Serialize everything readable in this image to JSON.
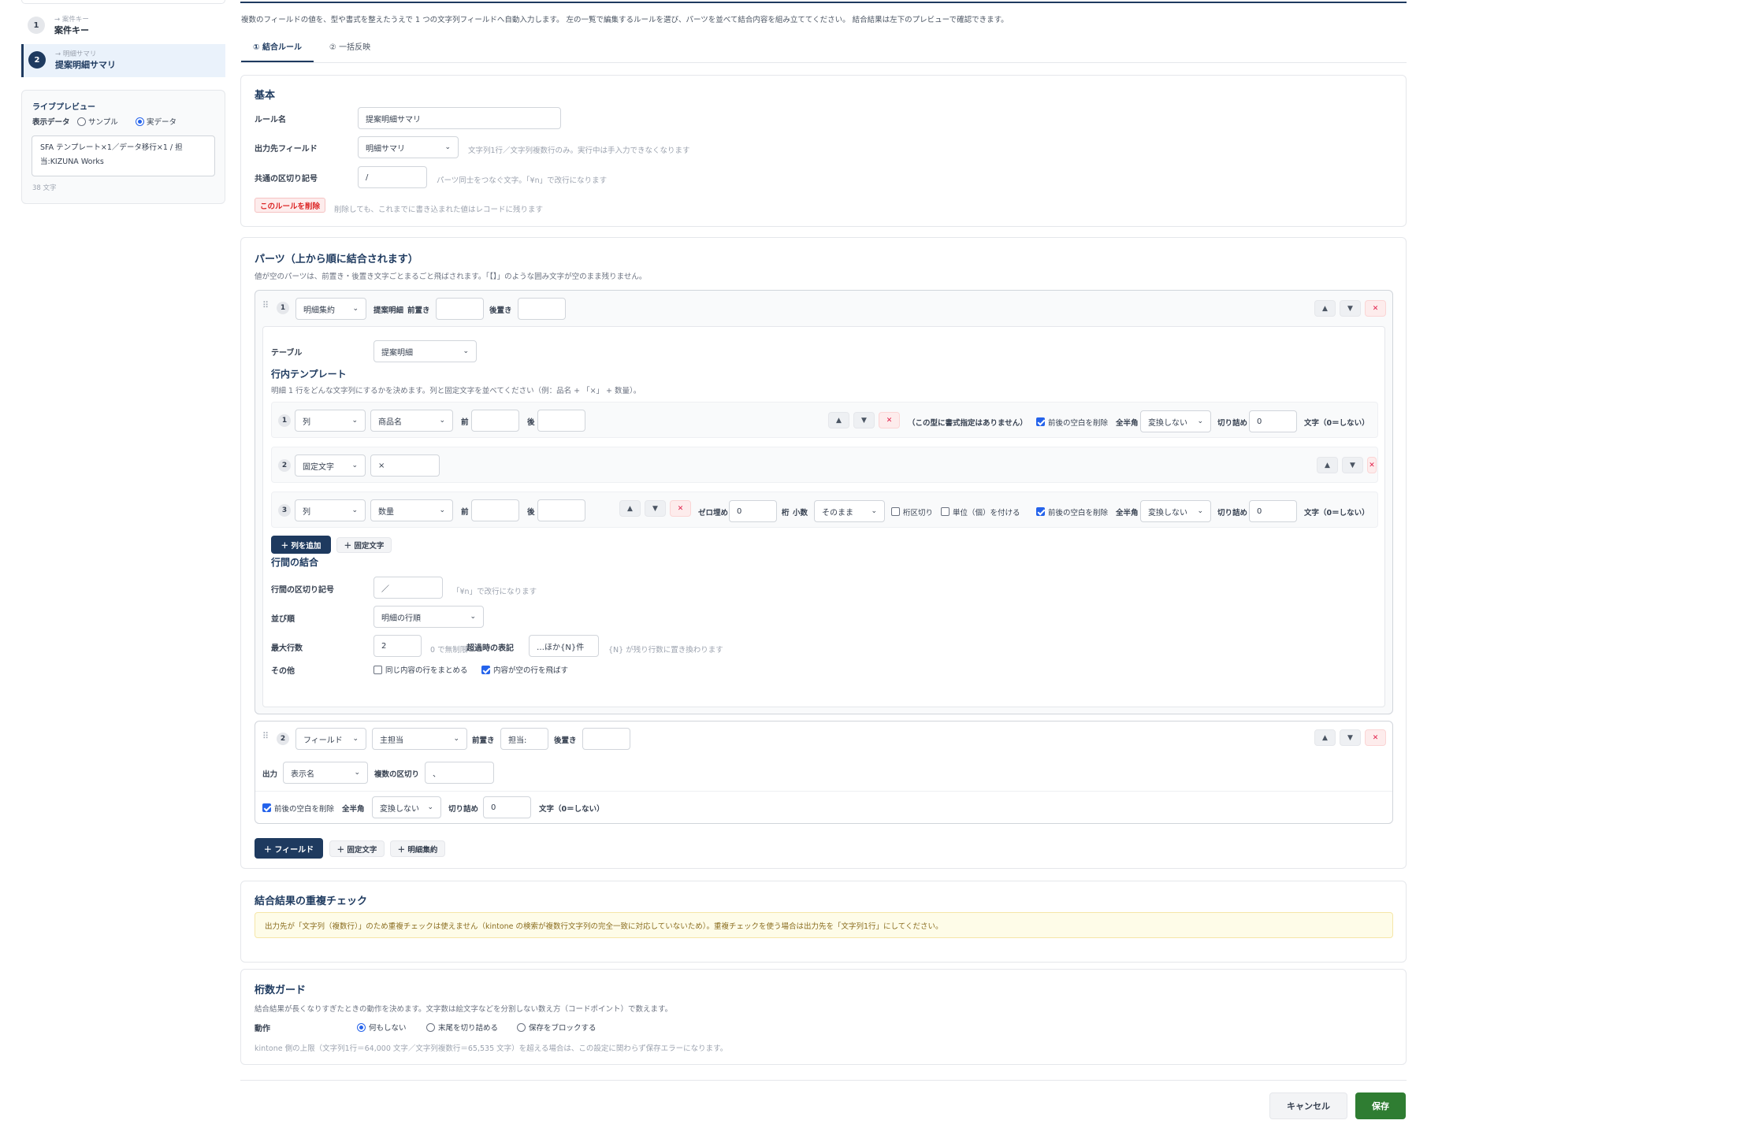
{
  "sidebar": {
    "steps": [
      {
        "num": "1",
        "small": "→ 案件キー",
        "name": "案件キー"
      },
      {
        "num": "2",
        "small": "→ 明細サマリ",
        "name": "提案明細サマリ"
      }
    ],
    "preview": {
      "title": "ライブプレビュー",
      "data_label": "表示データ",
      "option_sample": "サンプル",
      "option_real": "実データ",
      "text": "SFA テンプレート×1／データ移行×1 / 担当:KIZUNA Works",
      "count": "38 文字"
    }
  },
  "header": {
    "intro": "複数のフィールドの値を、型や書式を整えたうえで 1 つの文字列フィールドへ自動入力します。 左の一覧で編集するルールを選び、パーツを並べて結合内容を組み立ててください。 結合結果は左下のプレビューで確認できます。",
    "tabs": [
      "① 結合ルール",
      "② 一括反映"
    ]
  },
  "basic": {
    "title": "基本",
    "rule_name_label": "ルール名",
    "rule_name_value": "提案明細サマリ",
    "output_label": "出力先フィールド",
    "output_value": "明細サマリ",
    "output_note": "文字列1行／文字列複数行のみ。実行中は手入力できなくなります",
    "sep_label": "共通の区切り記号",
    "sep_value": "/",
    "sep_note": "パーツ同士をつなぐ文字。「¥n」で改行になります",
    "delete_button": "このルールを削除",
    "delete_note": "削除しても、これまでに書き込まれた値はレコードに残ります"
  },
  "parts": {
    "title": "パーツ（上から順に結合されます）",
    "desc": "値が空のパーツは、前置き・後置き文字ごとまるごと飛ばされます。「【】」のような囲み文字が空のまま残りません。",
    "part1": {
      "num": "1",
      "type": "明細集約",
      "tag": "提案明細",
      "pre_label": "前置き",
      "post_label": "後置き",
      "table_label": "テーブル",
      "table_value": "提案明細",
      "template_title": "行内テンプレート",
      "template_desc": "明細 1 行をどんな文字列にするかを決めます。列と固定文字を並べてください（例：品名 + 「×」 + 数量）。",
      "rows": [
        {
          "num": "1",
          "type": "列",
          "field": "商品名",
          "pre": "前",
          "post": "後",
          "fmt_note": "（この型に書式指定はありません）",
          "trim_label": "前後の空白を削除",
          "width_label": "全半角",
          "width_value": "変換しない",
          "cut_label": "切り詰め",
          "cut_value": "0",
          "cut_unit": "文字（0＝しない）"
        },
        {
          "num": "2",
          "type": "固定文字",
          "value": "×"
        },
        {
          "num": "3",
          "type": "列",
          "field": "数量",
          "pre": "前",
          "post": "後",
          "zero_label": "ゼロ埋め",
          "zero_value": "0",
          "digit_label": "桁",
          "dec_label": "小数",
          "dec_value": "そのまま",
          "comma_label": "桁区切り",
          "unit_label": "単位（個）を付ける",
          "trim_label": "前後の空白を削除",
          "width_label": "全半角",
          "width_value": "変換しない",
          "cut_label": "切り詰め",
          "cut_value": "0",
          "cut_unit": "文字（0＝しない）"
        }
      ],
      "add_col_button": "＋ 列を追加",
      "add_fixed_button": "＋ 固定文字",
      "join_title": "行間の結合",
      "row_sep_label": "行間の区切り記号",
      "row_sep_value": "／",
      "row_sep_note": "「¥n」で改行になります",
      "order_label": "並び順",
      "order_value": "明細の行順",
      "max_label": "最大行数",
      "max_value": "2",
      "max_note": "0 で無制限",
      "over_label": "超過時の表記",
      "over_value": "…ほか{N}件",
      "over_note": "{N} が残り行数に置き換わります",
      "other_label": "その他",
      "merge_label": "同じ内容の行をまとめる",
      "skip_label": "内容が空の行を飛ばす"
    },
    "part2": {
      "num": "2",
      "type": "フィールド",
      "field": "主担当",
      "pre_label": "前置き",
      "pre_value": "担当:",
      "post_label": "後置き",
      "out_label": "出力",
      "out_value": "表示名",
      "multi_label": "複数の区切り",
      "multi_value": "、",
      "trim_label": "前後の空白を削除",
      "width_label": "全半角",
      "width_value": "変換しない",
      "cut_label": "切り詰め",
      "cut_value": "0",
      "cut_unit": "文字（0＝しない）"
    },
    "add_field_button": "＋ フィールド",
    "add_fixed_button": "＋ 固定文字",
    "add_agg_button": "＋ 明細集約"
  },
  "dup": {
    "title": "結合結果の重複チェック",
    "warning": "出力先が「文字列（複数行）」のため重複チェックは使えません（kintone の検索が複数行文字列の完全一致に対応していないため）。重複チェックを使う場合は出力先を「文字列1行」にしてください。"
  },
  "guard": {
    "title": "桁数ガード",
    "desc": "結合結果が長くなりすぎたときの動作を決めます。文字数は絵文字などを分割しない数え方（コードポイント）で数えます。",
    "action_label": "動作",
    "options": [
      "何もしない",
      "末尾を切り詰める",
      "保存をブロックする"
    ],
    "note": "kintone 側の上限（文字列1行＝64,000 文字／文字列複数行＝65,535 文字）を超える場合は、この設定に関わらず保存エラーになります。"
  },
  "footer": {
    "cancel": "キャンセル",
    "save": "保存"
  },
  "icons": {
    "up": "▲",
    "down": "▼",
    "del": "✕",
    "drag": "⠿",
    "chev": "⌄"
  }
}
